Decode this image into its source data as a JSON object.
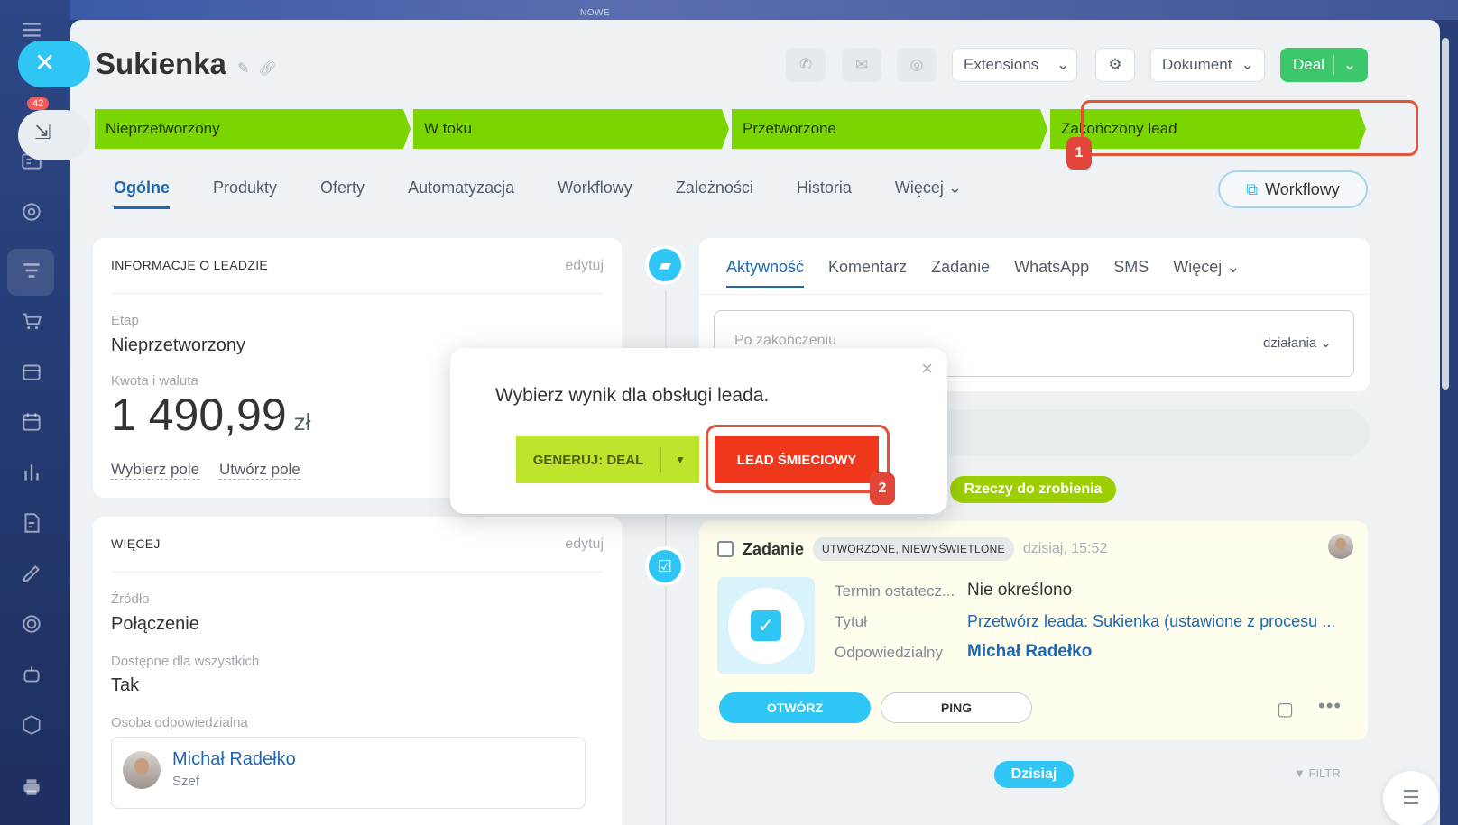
{
  "sidebar": {
    "counter": "42"
  },
  "top": {
    "new_label": "NOWE"
  },
  "header": {
    "title": "Sukienka",
    "extensions_label": "Extensions",
    "document_label": "Dokument",
    "deal_label": "Deal"
  },
  "stages": [
    {
      "label": "Nieprzetworzony"
    },
    {
      "label": "W toku"
    },
    {
      "label": "Przetworzone"
    },
    {
      "label": "Zakończony lead"
    }
  ],
  "steps": {
    "one": "1",
    "two": "2"
  },
  "tabs": {
    "items": [
      "Ogólne",
      "Produkty",
      "Oferty",
      "Automatyzacja",
      "Workflowy",
      "Zależności",
      "Historia",
      "Więcej"
    ],
    "workflow_button": "Workflowy"
  },
  "lead_info": {
    "heading": "INFORMACJE O LEADZIE",
    "edit": "edytuj",
    "stage_label": "Etap",
    "stage_value": "Nieprzetworzony",
    "amount_label": "Kwota i waluta",
    "amount_value": "1 490,99",
    "currency": "zł",
    "select_field": "Wybierz pole",
    "create_field": "Utwórz pole"
  },
  "more_info": {
    "heading": "WIĘCEJ",
    "edit": "edytuj",
    "source_label": "Źródło",
    "source_value": "Połączenie",
    "available_label": "Dostępne dla wszystkich",
    "available_value": "Tak",
    "responsible_label": "Osoba odpowiedzialna",
    "person_name": "Michał Radełko",
    "person_role": "Szef"
  },
  "activity": {
    "tabs": [
      "Aktywność",
      "Komentarz",
      "Zadanie",
      "WhatsApp",
      "SMS",
      "Więcej"
    ],
    "input_placeholder": "Po zakończeniu",
    "actions_label": "działania"
  },
  "timeline": {
    "todo_label": "Rzeczy do zrobienia",
    "today_label": "Dzisiaj",
    "filter_label": "FILTR"
  },
  "task": {
    "title": "Zadanie",
    "status_badge": "UTWORZONE, NIEWYŚWIETLONE",
    "time": "dzisiaj, 15:52",
    "deadline_label": "Termin ostatecz...",
    "deadline_value": "Nie określono",
    "title_label": "Tytuł",
    "title_value": "Przetwórz leada: Sukienka (ustawione z procesu ...",
    "responsible_label": "Odpowiedzialny",
    "responsible_value": "Michał Radełko",
    "open_button": "OTWÓRZ",
    "ping_button": "PING"
  },
  "modal": {
    "question": "Wybierz wynik dla obsługi leada.",
    "generate_button": "GENERUJ: DEAL",
    "junk_button": "LEAD ŚMIECIOWY"
  },
  "colors": {
    "stage_green": "#7bd500",
    "accent_blue": "#2fc6f6",
    "link_blue": "#2067b0",
    "deal_green": "#3bc76a",
    "junk_red": "#f0371b",
    "generate_lime": "#bde52b",
    "highlight_red": "#e2533a"
  }
}
